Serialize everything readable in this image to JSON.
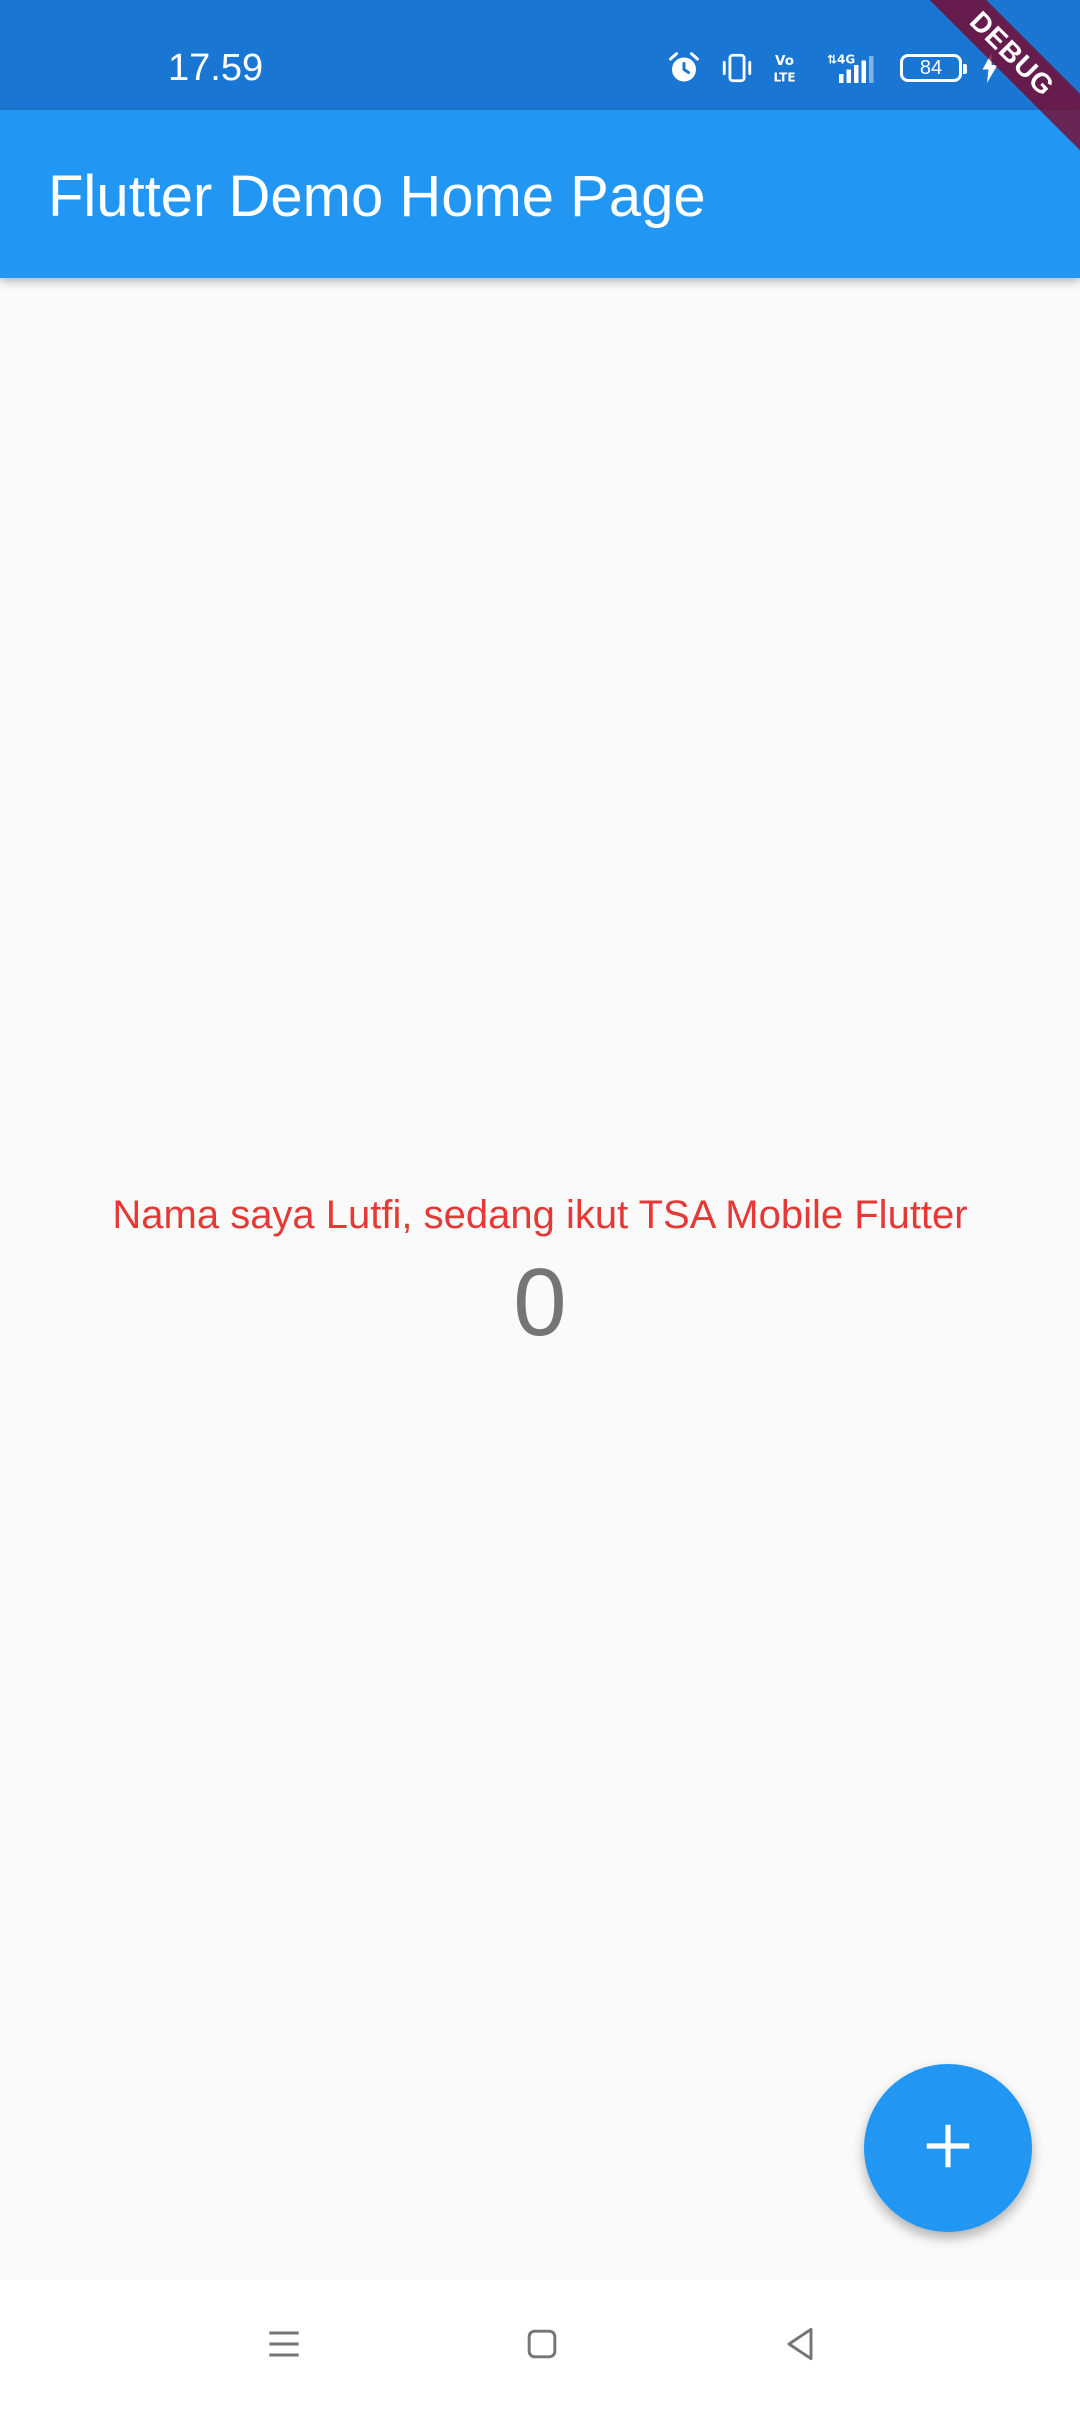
{
  "status_bar": {
    "time": "17.59",
    "battery_level": "84",
    "icons": [
      "alarm-icon",
      "vibrate-icon",
      "volte-icon",
      "signal-4g-icon",
      "battery-icon",
      "charging-icon"
    ]
  },
  "app_bar": {
    "title": "Flutter Demo Home Page"
  },
  "debug_banner": {
    "label": "DEBUG"
  },
  "body": {
    "message": "Nama saya Lutfi, sedang ikut TSA Mobile Flutter",
    "counter": "0"
  },
  "fab": {
    "icon": "plus-icon"
  },
  "nav_bar": {
    "icons": [
      "menu-icon",
      "home-square-icon",
      "back-triangle-icon"
    ]
  },
  "colors": {
    "status_bar": "#1976d2",
    "app_bar": "#2196f3",
    "background": "#fafafa",
    "message_text": "#e53935",
    "counter_text": "#757575",
    "debug_banner": "#800020"
  }
}
